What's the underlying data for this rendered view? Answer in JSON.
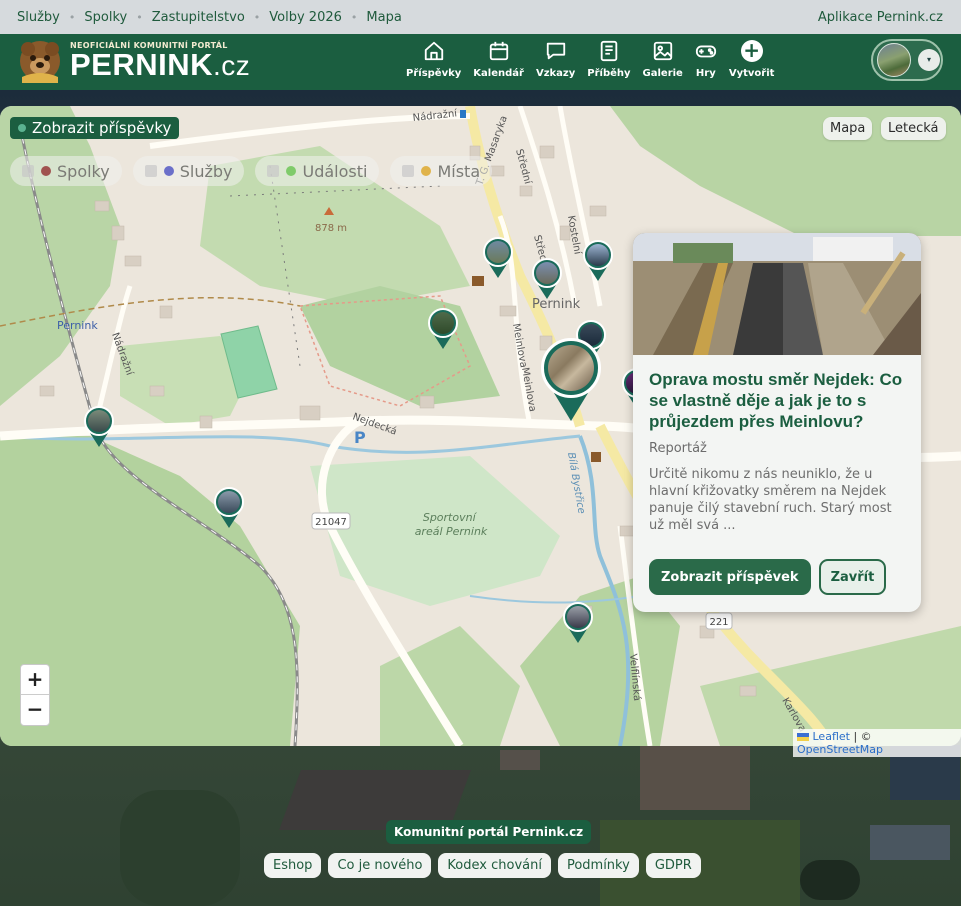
{
  "topbar": {
    "links": [
      "Služby",
      "Spolky",
      "Zastupitelstvo",
      "Volby 2026",
      "Mapa"
    ],
    "app_link": "Aplikace Pernink.cz"
  },
  "header": {
    "logo_subtitle": "NEOFICIÁLNÍ KOMUNITNÍ PORTÁL",
    "logo_main": "PERNINK",
    "logo_tld": ".cz",
    "nav": [
      {
        "label": "Příspěvky",
        "icon": "home-icon"
      },
      {
        "label": "Kalendář",
        "icon": "calendar-icon"
      },
      {
        "label": "Vzkazy",
        "icon": "chat-icon"
      },
      {
        "label": "Příběhy",
        "icon": "document-icon"
      },
      {
        "label": "Galerie",
        "icon": "image-icon"
      },
      {
        "label": "Hry",
        "icon": "gamepad-icon"
      },
      {
        "label": "Vytvořit",
        "icon": "plus-icon"
      }
    ],
    "user_menu_caret": "▾"
  },
  "map": {
    "show_posts_label": "Zobrazit příspěvky",
    "layer_buttons": [
      "Mapa",
      "Letecká"
    ],
    "filters": [
      {
        "label": "Spolky",
        "color": "#a0524f"
      },
      {
        "label": "Služby",
        "color": "#6b6fc9"
      },
      {
        "label": "Události",
        "color": "#7fcb6a"
      },
      {
        "label": "Místa",
        "color": "#e0b34a"
      }
    ],
    "labels": {
      "peak": "878 m",
      "town": "Pernink",
      "station": "Pernink",
      "street_nadrazni": "Nádražní",
      "street_nadrazni_2": "Nádražní",
      "street_tg": "T. G. Masaryka",
      "street_stredni": "Střední",
      "street_stredni_2": "Střední",
      "street_kostelni": "Kostelní",
      "street_meinlova": "Meinlova",
      "street_meinlova_2": "Meinlova",
      "street_nejdecka": "Nejdecká",
      "river": "Bílá Bystřice",
      "sports_area": "Sportovní areál Pernink",
      "road_21047": "21047",
      "road_221": "221",
      "street_velflinska": "Velflínská",
      "street_karlova": "Karlova",
      "parking": "P"
    },
    "zoom_in": "+",
    "zoom_out": "−",
    "attribution_leaflet": "Leaflet",
    "attribution_sep": " | © ",
    "attribution_osm": "OpenStreetMap"
  },
  "popup": {
    "title": "Oprava mostu směr Nejdek: Co se vlastně děje a jak je to s průjezdem přes Meinlovu?",
    "type": "Reportáž",
    "excerpt": "Určitě nikomu z nás neuniklo, že u hlavní křižovatky směrem na Nejdek panuje čilý stavební ruch. Starý most už měl svá ...",
    "primary_label": "Zobrazit příspěvek",
    "secondary_label": "Zavřít"
  },
  "footer": {
    "title": "Komunitní portál Pernink.cz",
    "links": [
      "Eshop",
      "Co je nového",
      "Kodex chování",
      "Podmínky",
      "GDPR"
    ]
  }
}
